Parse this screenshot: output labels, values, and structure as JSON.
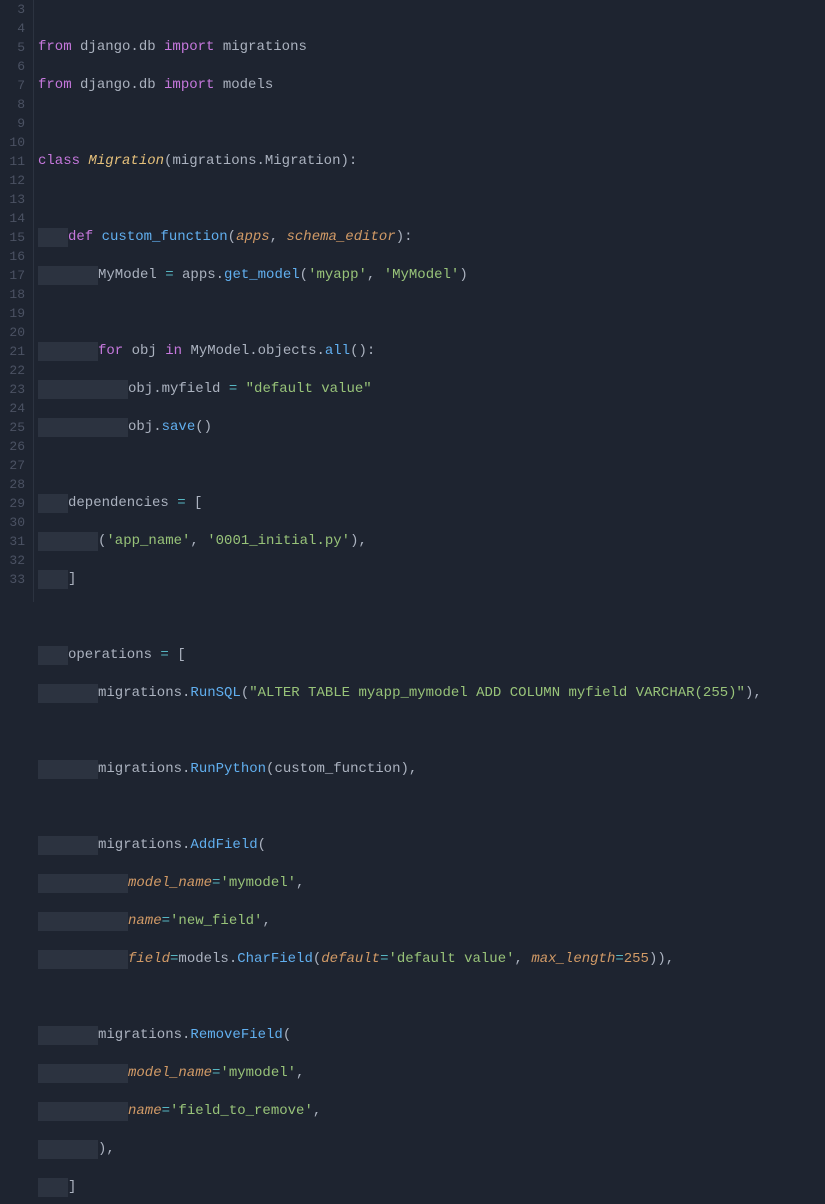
{
  "gutter": {
    "start": 3,
    "end": 33
  },
  "lines": {
    "l3": {
      "kw1": "from",
      "mod1": " django.db ",
      "kw2": "import",
      "mod2": " migrations"
    },
    "l4": {
      "kw1": "from",
      "mod1": " django.db ",
      "kw2": "import",
      "mod2": " models"
    },
    "l6": {
      "kw": "class",
      "sp": " ",
      "cls": "Migration",
      "p1": "(",
      "base": "migrations",
      "dot": ".",
      "attr": "Migration",
      "p2": "):"
    },
    "l8": {
      "kw": "def",
      "sp": " ",
      "fn": "custom_function",
      "p1": "(",
      "a1": "apps",
      "c": ", ",
      "a2": "schema_editor",
      "p2": "):"
    },
    "l9": {
      "v": "MyModel ",
      "op": "=",
      "sp": " apps.",
      "fn": "get_model",
      "p1": "(",
      "s1": "'myapp'",
      "c": ", ",
      "s2": "'MyModel'",
      "p2": ")"
    },
    "l11": {
      "kw1": "for",
      "v": " obj ",
      "kw2": "in",
      "sp": " MyModel.objects.",
      "fn": "all",
      "p": "():"
    },
    "l12": {
      "pre": "obj.myfield ",
      "op": "=",
      "sp": " ",
      "s": "\"default value\""
    },
    "l13": {
      "pre": "obj.",
      "fn": "save",
      "p": "()"
    },
    "l15": {
      "v": "dependencies ",
      "op": "=",
      "sp": " [",
      "p": ""
    },
    "l16": {
      "p1": "(",
      "s1": "'app_name'",
      "c": ", ",
      "s2": "'0001_initial.py'",
      "p2": "),"
    },
    "l17": {
      "p": "]"
    },
    "l19": {
      "v": "operations ",
      "op": "=",
      "sp": " ["
    },
    "l20": {
      "pre": "migrations.",
      "fn": "RunSQL",
      "p1": "(",
      "s": "\"ALTER TABLE myapp_mymodel ADD COLUMN myfield VARCHAR(255)\"",
      "p2": "),"
    },
    "l22": {
      "pre": "migrations.",
      "fn": "RunPython",
      "p1": "(",
      "a": "custom_function",
      "p2": "),"
    },
    "l24": {
      "pre": "migrations.",
      "fn": "AddField",
      "p": "("
    },
    "l25": {
      "k": "model_name",
      "op": "=",
      "s": "'mymodel'",
      "c": ","
    },
    "l26": {
      "k": "name",
      "op": "=",
      "s": "'new_field'",
      "c": ","
    },
    "l27": {
      "k": "field",
      "op": "=",
      "pre": "models.",
      "fn": "CharField",
      "p1": "(",
      "k2": "default",
      "op2": "=",
      "s": "'default value'",
      "c": ", ",
      "k3": "max_length",
      "op3": "=",
      "n": "255",
      "p2": ")),"
    },
    "l29": {
      "pre": "migrations.",
      "fn": "RemoveField",
      "p": "("
    },
    "l30": {
      "k": "model_name",
      "op": "=",
      "s": "'mymodel'",
      "c": ","
    },
    "l31": {
      "k": "name",
      "op": "=",
      "s": "'field_to_remove'",
      "c": ","
    },
    "l32": {
      "p": "),"
    },
    "l33": {
      "p": "]"
    }
  }
}
